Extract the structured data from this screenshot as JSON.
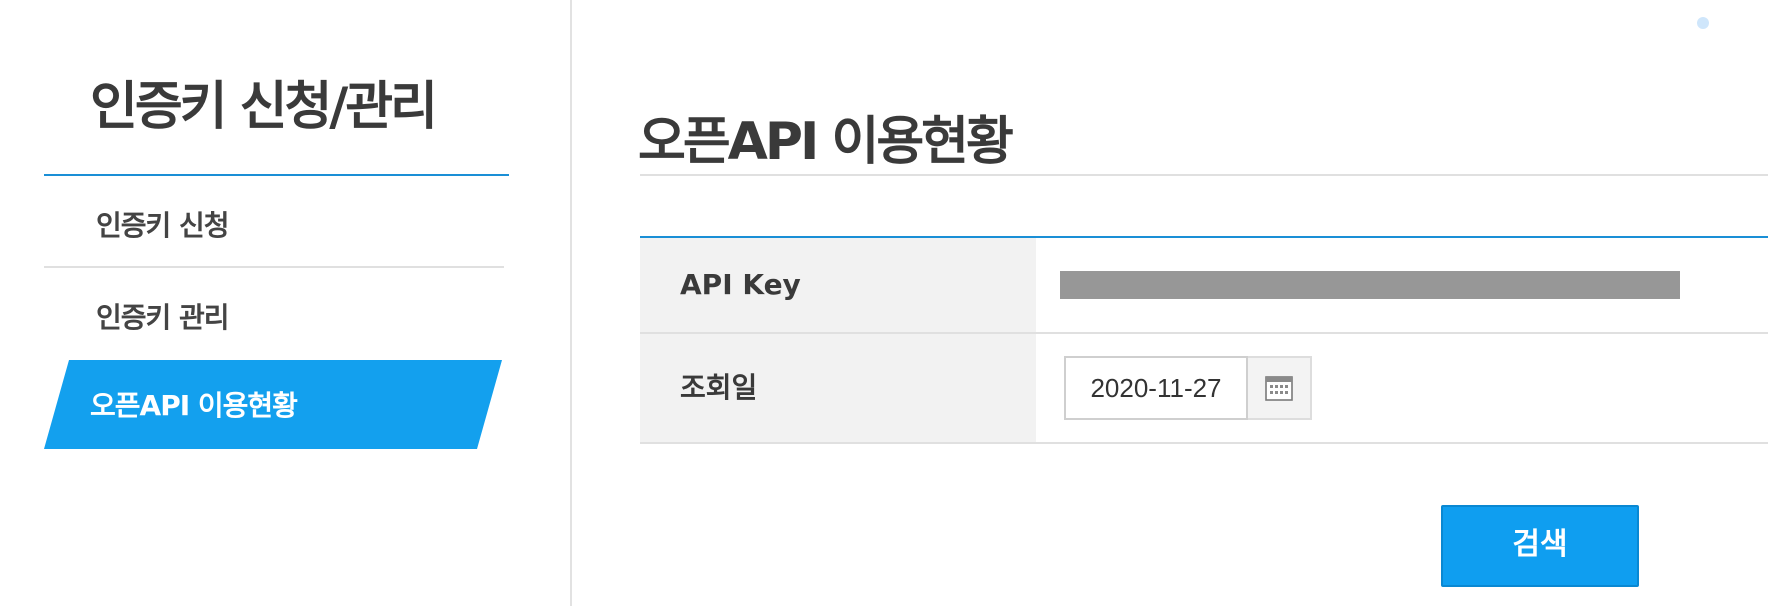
{
  "sidebar": {
    "title": "인증키 신청/관리",
    "items": [
      {
        "label": "인증키 신청",
        "active": false
      },
      {
        "label": "인증키 관리",
        "active": false
      },
      {
        "label": "오픈API 이용현황",
        "active": true
      }
    ]
  },
  "main": {
    "title": "오픈API 이용현황",
    "form": {
      "api_key_label": "API Key",
      "date_label": "조회일",
      "date_value": "2020-11-27"
    },
    "search_button_label": "검색"
  },
  "colors": {
    "accent": "#13a0ee",
    "rule": "#1a8fd6",
    "label_bg": "#f2f2f2",
    "redacted": "#979797"
  },
  "icons": [
    "calendar-icon"
  ]
}
